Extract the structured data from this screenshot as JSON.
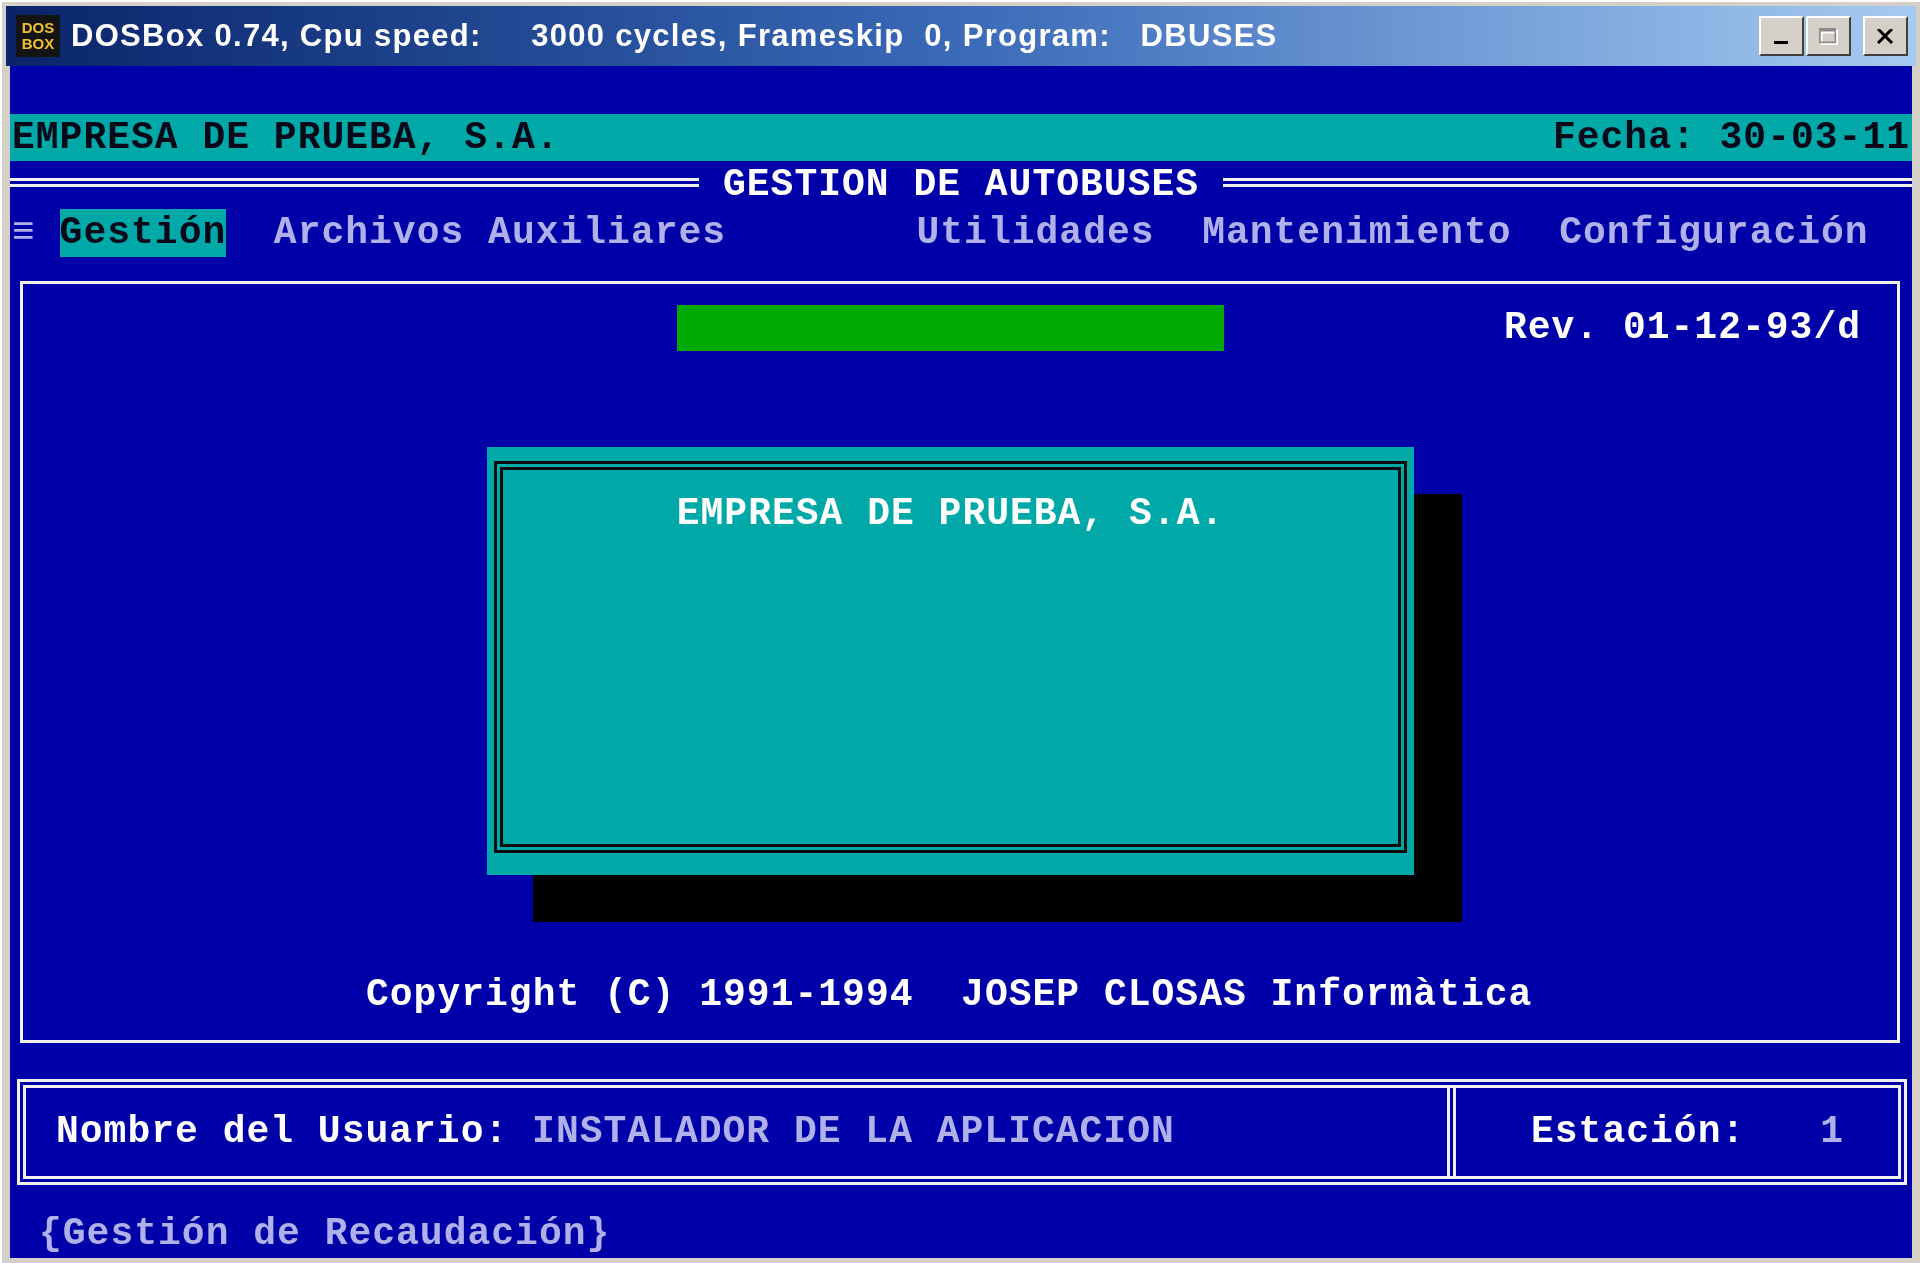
{
  "window": {
    "title": "DOSBox 0.74, Cpu speed:     3000 cycles, Frameskip  0, Program:   DBUSES",
    "app_icon_text": [
      "DOS",
      "BOX"
    ],
    "controls": [
      {
        "kind": "minimize",
        "disabled": false
      },
      {
        "kind": "maximize",
        "disabled": true
      },
      {
        "kind": "close",
        "disabled": false
      }
    ]
  },
  "header": {
    "company": "EMPRESA DE PRUEBA, S.A.",
    "date": "Fecha: 30-03-11"
  },
  "app_title": "GESTION DE AUTOBUSES",
  "menu": {
    "system_glyph": "≡",
    "items": [
      {
        "label": "Gestión",
        "selected": true
      },
      {
        "label": "Archivos Auxiliares",
        "selected": false
      },
      {
        "label": "Utilidades",
        "selected": false
      },
      {
        "label": "Mantenimiento",
        "selected": false
      },
      {
        "label": "Configuración",
        "selected": false
      }
    ]
  },
  "main_panel": {
    "revision": "Rev. 01-12-93/d",
    "dialog": {
      "text": "EMPRESA DE PRUEBA, S.A."
    },
    "copyright": "Copyright (C) 1991-1994  JOSEP CLOSAS Informàtica"
  },
  "user_panel": {
    "user_label": "Nombre del Usuario:",
    "user_value": "INSTALADOR DE LA APLICACION",
    "station_label": "Estación:",
    "station_value": "1"
  },
  "status_line": "{Gestión de Recaudación}"
}
